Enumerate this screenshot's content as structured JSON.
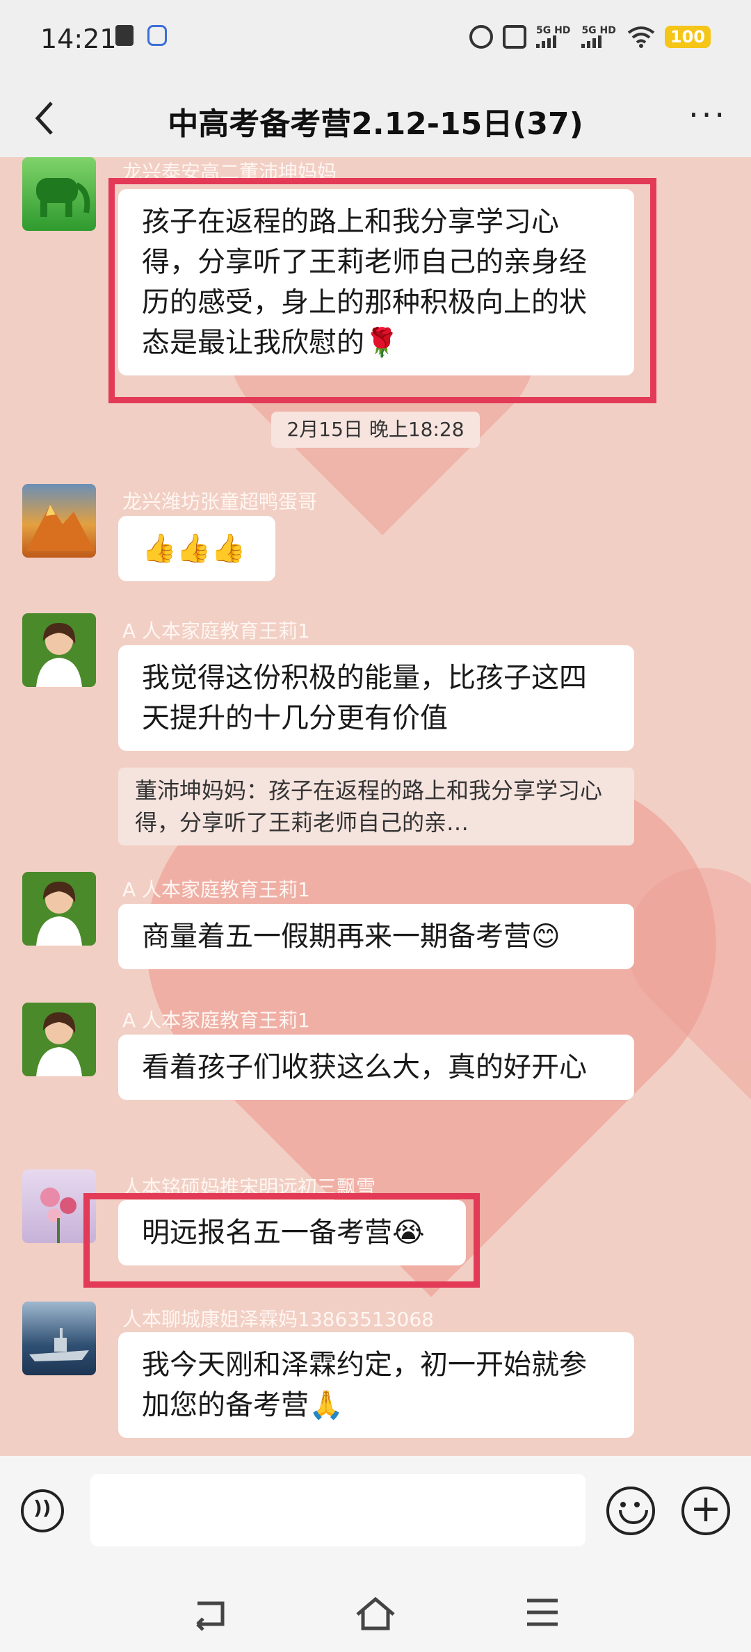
{
  "status_bar": {
    "time": "14:21",
    "signal1_label": "5G HD",
    "signal2_label": "5G HD",
    "battery": "100",
    "icons": [
      "alarm-icon",
      "mute-icon",
      "wifi-icon"
    ]
  },
  "header": {
    "back_icon": "chevron-left-icon",
    "title": "中高考备考营2.12-15日(37)",
    "more_icon": "more-icon",
    "more_glyph": "···"
  },
  "messages": [
    {
      "sender": "龙兴泰安高二董沛坤妈妈",
      "text": "孩子在返程的路上和我分享学习心得，分享听了王莉老师自己的亲身经历的感受，身上的那种积极向上的状态是最让我欣慰的🌹",
      "avatar": "elephant-avatar"
    },
    {
      "sender": "龙兴潍坊张童超鸭蛋哥",
      "text": "👍👍👍",
      "avatar": "mountain-avatar"
    },
    {
      "sender": "A 人本家庭教育王莉1",
      "text": "我觉得这份积极的能量，比孩子这四天提升的十几分更有价值",
      "quote": "董沛坤妈妈：孩子在返程的路上和我分享学习心得，分享听了王莉老师自己的亲…",
      "avatar": "woman-avatar"
    },
    {
      "sender": "A 人本家庭教育王莉1",
      "text": "商量着五一假期再来一期备考营😊",
      "avatar": "woman-avatar"
    },
    {
      "sender": "A 人本家庭教育王莉1",
      "text": "看着孩子们收获这么大，真的好开心",
      "avatar": "woman-avatar"
    },
    {
      "sender": "人本铭硕妈推宋明远初三飘雪",
      "text": "明远报名五一备考营😭",
      "avatar": "flower-avatar"
    },
    {
      "sender": "人本聊城康姐泽霖妈13863513068",
      "text": "我今天刚和泽霖约定，初一开始就参加您的备考营🙏",
      "avatar": "ship-avatar"
    }
  ],
  "timestamp": "2月15日 晚上18:28",
  "input_bar": {
    "voice_icon": "voice-icon",
    "emoji_icon": "emoji-icon",
    "plus_icon": "plus-icon",
    "plus_glyph": "+"
  },
  "nav_bar": {
    "back_glyph": "⮌",
    "home_glyph": "⌂",
    "menu_glyph": "≡"
  },
  "colors": {
    "highlight": "#e23a57",
    "background": "#f2cfc4",
    "bubble": "#ffffff"
  }
}
